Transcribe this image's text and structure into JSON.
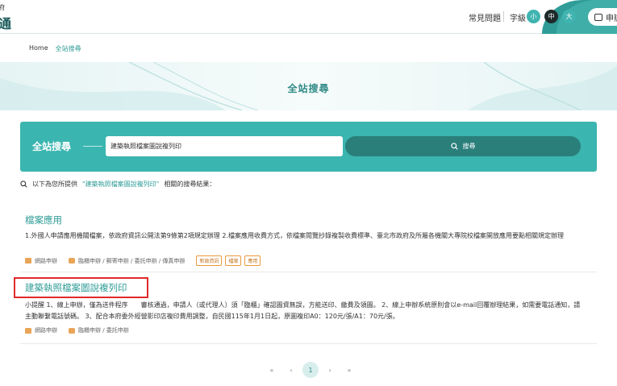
{
  "header": {
    "logo_line1": "府",
    "logo_line2": "通",
    "faq": "常見問題",
    "font_size_label": "字級",
    "font_small": "小",
    "font_mid": "中",
    "font_large": "大",
    "apply": "申辦"
  },
  "breadcrumb": {
    "home": "Home",
    "current": "全站搜尋"
  },
  "banner": {
    "title": "全站搜尋"
  },
  "search": {
    "label": "全站搜尋",
    "value": "建築執照檔案圖說複列印",
    "button": "搜尋"
  },
  "summary": {
    "prefix": "以下為您所提供",
    "keyword": "\"建築執照檔案圖說複列印\"",
    "suffix": "相關的搜尋結果："
  },
  "results": [
    {
      "title": "檔案應用",
      "desc": "1.外國人申請應用機關檔案，依政府資訊公開法第9條第2項規定辦理 2.檔案應用收費方式，依檔案閱覽抄錄複製收費標準、臺北市政府及所屬各機關大專院校檔案開放應用要點相關規定辦理",
      "meta1": "網路申辦",
      "meta2": "臨櫃申辦 / 郵寄申辦 / 委託申辦 / 傳真申辦",
      "tags": [
        "新政資訊",
        "檔案",
        "應用"
      ]
    },
    {
      "title": "建築執照檔案圖說複列印",
      "desc": "小提醒 1、線上申辦，僅為送件程序　　審核通過，申請人（或代理人）須「臨櫃」確認圖資無誤，方能送印、繳費及領圖。 2、線上申辦系統原則會以e-mail回覆辦理結果，如需要電話通知，請主動聯繫電話號碼。 3、配合本府委外經營影印店複印費用調整，自民國115年1月1日起，原圖複印A0：120元/張/A1：70元/張。",
      "meta1": "網路申辦",
      "meta2": "臨櫃申辦 / 委託申辦"
    }
  ],
  "pagination": {
    "first": "«",
    "prev": "‹",
    "current": "1",
    "next": "›",
    "last": "»"
  },
  "colors": {
    "accent": "#3bb5b0",
    "accent_dark": "#2a7f7b",
    "highlight_box": "#e02a2a",
    "tag_border": "#e89a3b"
  }
}
